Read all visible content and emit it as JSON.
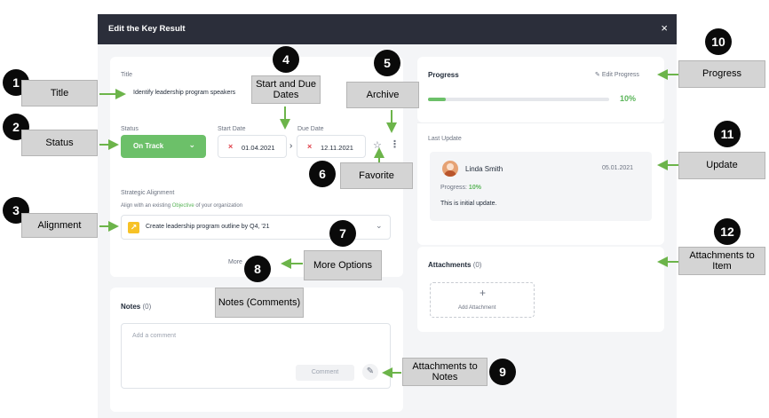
{
  "modal": {
    "title": "Edit the Key Result",
    "close_icon": "×"
  },
  "form": {
    "title_label": "Title",
    "title_value": "Identify leadership program speakers",
    "status_label": "Status",
    "status_value": "On Track",
    "start_date_label": "Start Date",
    "start_date_value": "01.04.2021",
    "due_date_label": "Due Date",
    "due_date_value": "12.11.2021",
    "alignment_label": "Strategic Alignment",
    "alignment_hint_pre": "Align with an existing ",
    "alignment_hint_link": "Objective",
    "alignment_hint_post": " of your organization",
    "alignment_value": "Create leadership program outline by Q4, '21",
    "more_options_label": "More"
  },
  "notes": {
    "label": "Notes",
    "count": "(0)",
    "placeholder": "Add a comment",
    "comment_button": "Comment"
  },
  "progress": {
    "label": "Progress",
    "edit_label": "Edit Progress",
    "value_text": "10%",
    "value_fraction": 0.1
  },
  "last_update": {
    "label": "Last Update",
    "author": "Linda Smith",
    "date": "05.01.2021",
    "progress_label": "Progress:",
    "progress_value": "10%",
    "text": "This is initial update."
  },
  "attachments": {
    "label": "Attachments",
    "count": "(0)",
    "add_label": "Add Attachment",
    "plus": "+"
  },
  "annotations": [
    {
      "number": "1",
      "text": "Title"
    },
    {
      "number": "2",
      "text": "Status"
    },
    {
      "number": "3",
      "text": "Alignment"
    },
    {
      "number": "4",
      "text": "Start and Due Dates"
    },
    {
      "number": "5",
      "text": "Archive"
    },
    {
      "number": "6",
      "text": "Favorite"
    },
    {
      "number": "7",
      "text": "More Options"
    },
    {
      "number": "8",
      "text": "Notes (Comments)"
    },
    {
      "number": "9",
      "text": "Attachments to Notes"
    },
    {
      "number": "10",
      "text": "Progress"
    },
    {
      "number": "11",
      "text": "Update"
    },
    {
      "number": "12",
      "text": "Attachments to Item"
    }
  ],
  "colors": {
    "header": "#2b2e3a",
    "accent_green": "#6cc069",
    "annotation_arrow": "#6cb44a",
    "date_clear": "#e0424b"
  }
}
